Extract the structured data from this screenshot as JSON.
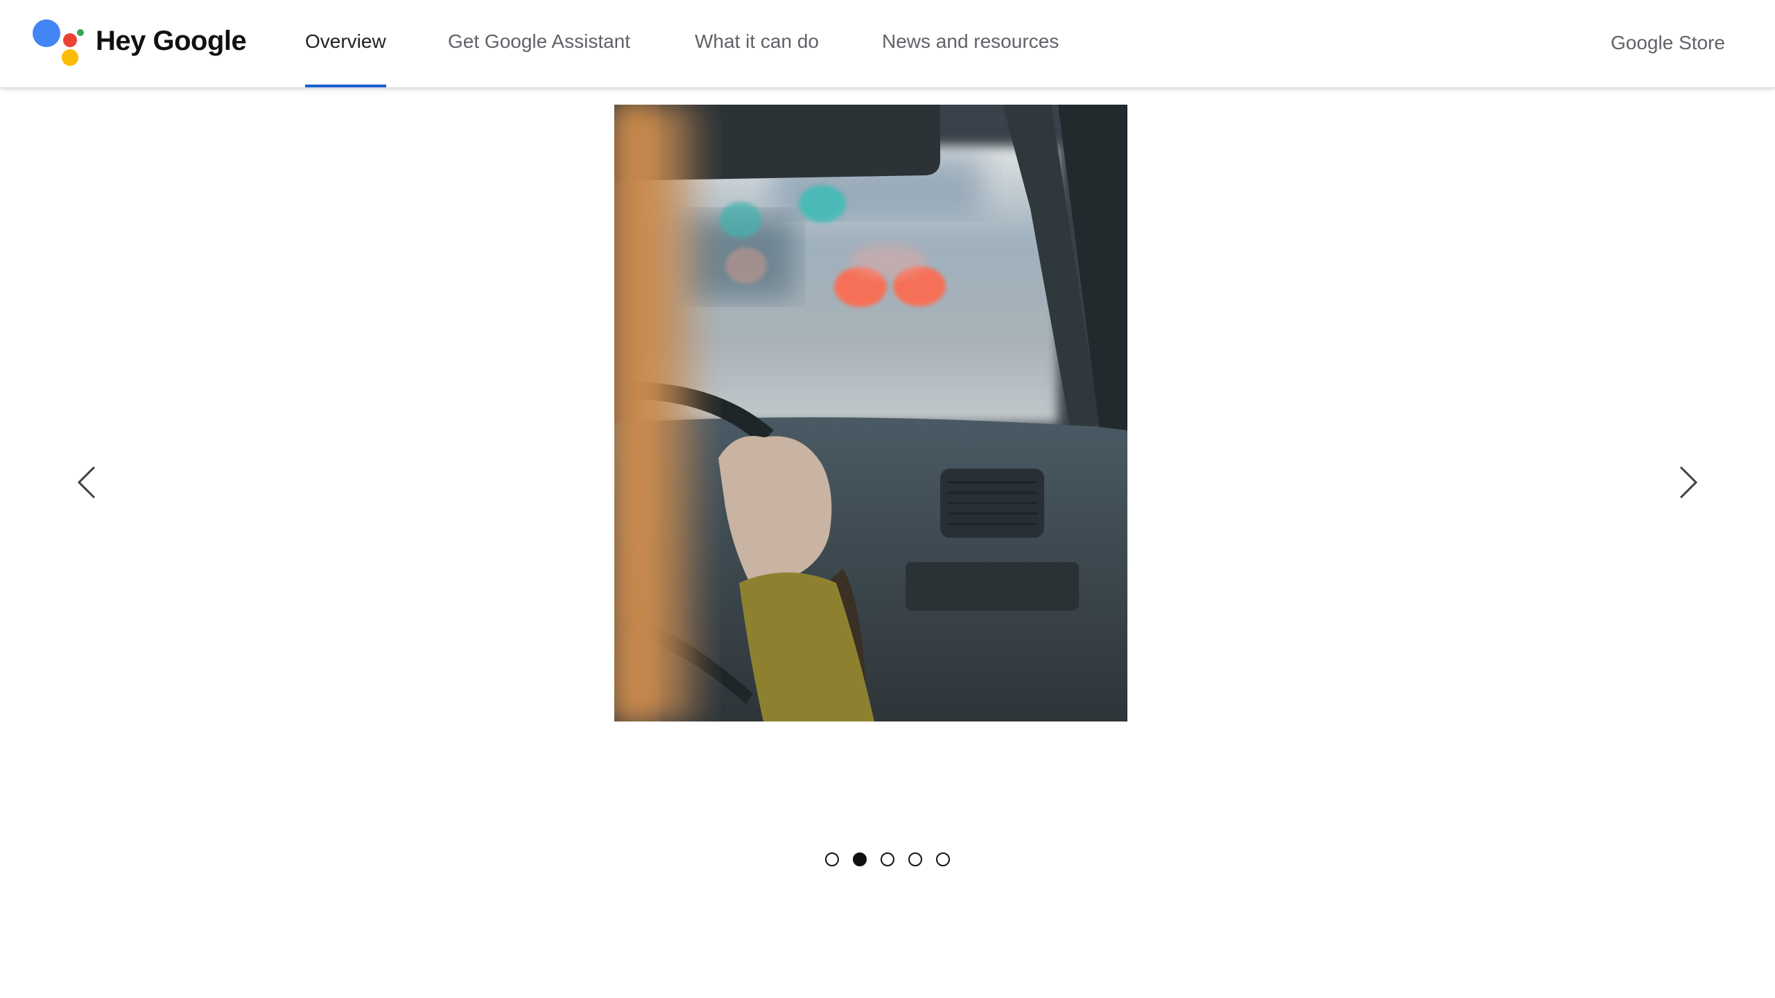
{
  "header": {
    "brand": "Hey Google",
    "logo_icon": "google-assistant-logo",
    "logo_colors": {
      "blue": "#4285f4",
      "red": "#ea4335",
      "green": "#34a853",
      "yellow": "#fbbc05"
    },
    "nav": [
      {
        "label": "Overview",
        "active": true
      },
      {
        "label": "Get Google Assistant",
        "active": false
      },
      {
        "label": "What it can do",
        "active": false
      },
      {
        "label": "News and resources",
        "active": false
      }
    ],
    "store_link": "Google Store",
    "accent_color": "#1a5fd0"
  },
  "carousel": {
    "slide_description": "Person driving a car, hand on steering wheel, blurred traffic lights ahead",
    "prev_icon": "chevron-left-icon",
    "next_icon": "chevron-right-icon",
    "slide_count": 5,
    "current_index": 1
  }
}
